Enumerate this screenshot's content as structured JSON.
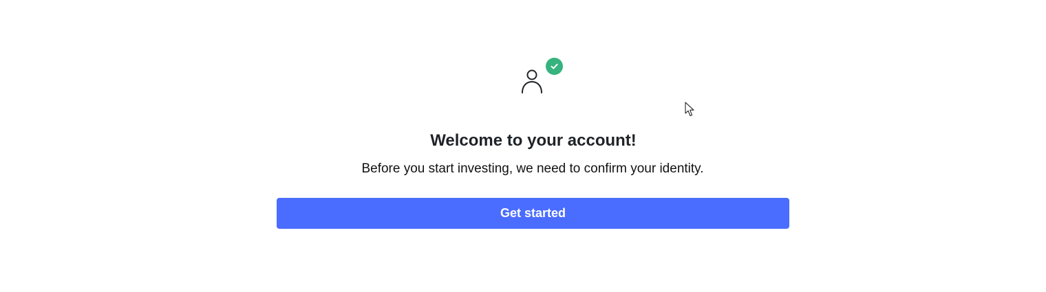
{
  "welcome": {
    "title": "Welcome to your account!",
    "subtitle": "Before you start investing, we need to confirm your identity.",
    "button_label": "Get started"
  },
  "icons": {
    "user": "user-icon",
    "verified_badge": "check-circle-icon",
    "cursor": "mouse-pointer-icon"
  },
  "colors": {
    "accent": "#4a6cff",
    "success": "#36b37e",
    "text": "#1f2328"
  }
}
